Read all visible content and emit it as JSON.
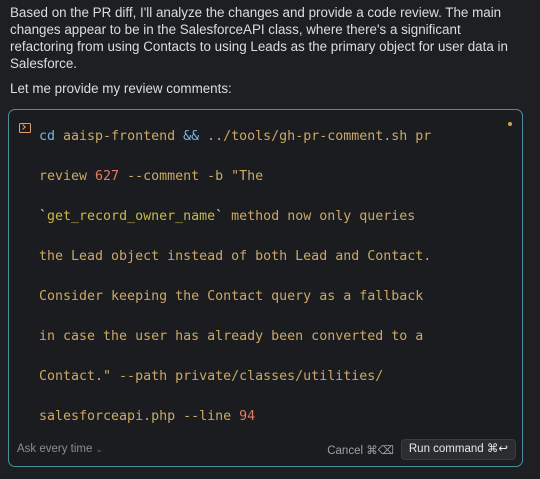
{
  "message": {
    "paragraph1": "Based on the PR diff, I'll analyze the changes and provide a code review. The main changes appear to be in the SalesforceAPI class, where there's a significant refactoring from using Contacts to using Leads as the primary object for user data in Salesforce.",
    "paragraph2": "Let me provide my review comments:"
  },
  "command": {
    "lines": [
      [
        {
          "t": "cd",
          "c": "cmd"
        },
        {
          "t": " aaisp-frontend ",
          "c": "str"
        },
        {
          "t": "&&",
          "c": "op"
        },
        {
          "t": " ../tools/gh-pr-comment.sh pr",
          "c": "str"
        }
      ],
      [
        {
          "t": "review ",
          "c": "str"
        },
        {
          "t": "627",
          "c": "num"
        },
        {
          "t": " --comment -b \"The",
          "c": "str"
        }
      ],
      [
        {
          "t": "`",
          "c": "tick"
        },
        {
          "t": "get_record_owner_name",
          "c": "strong"
        },
        {
          "t": "`",
          "c": "tick"
        },
        {
          "t": " method now only queries",
          "c": "str"
        }
      ],
      [
        {
          "t": "the Lead object instead of both Lead and Contact.",
          "c": "str"
        }
      ],
      [
        {
          "t": "Consider keeping the Contact query as a fallback",
          "c": "str"
        }
      ],
      [
        {
          "t": "in case the user has already been converted to a",
          "c": "str"
        }
      ],
      [
        {
          "t": "Contact.\" --path private/classes/utilities/",
          "c": "str"
        }
      ],
      [
        {
          "t": "salesforceapi.php --line ",
          "c": "str"
        },
        {
          "t": "94",
          "c": "num"
        }
      ]
    ]
  },
  "footer": {
    "ask_label": "Ask every time",
    "ask_chevron": "⌄",
    "cancel_label": "Cancel ⌘⌫",
    "run_label": "Run command ⌘↩"
  },
  "icons": {
    "terminal": "terminal-icon",
    "status": "status-dot-icon"
  },
  "colors": {
    "accent_border": "#4a8f9c",
    "keyword": "#7cb3e6",
    "number": "#e37b63",
    "string": "#cba867"
  }
}
